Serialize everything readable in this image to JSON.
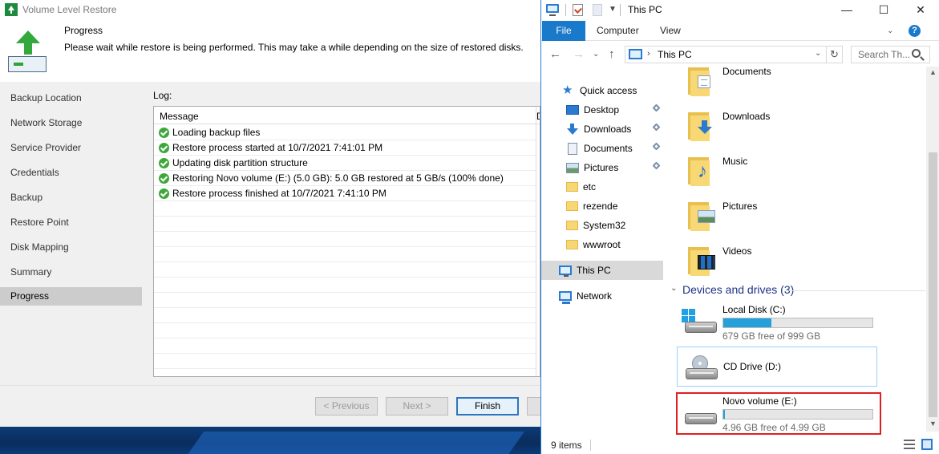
{
  "wizard": {
    "title": "Volume Level Restore",
    "header": {
      "title": "Progress",
      "description": "Please wait while restore is being performed. This may take a while depending on the size of restored disks."
    },
    "nav": [
      "Backup Location",
      "Network Storage",
      "Service Provider",
      "Credentials",
      "Backup",
      "Restore Point",
      "Disk Mapping",
      "Summary",
      "Progress"
    ],
    "active_step": "Progress",
    "log": {
      "label": "Log:",
      "column_message": "Message",
      "column_duration": "D",
      "entries": [
        {
          "status": "success",
          "message": "Loading backup files"
        },
        {
          "status": "success",
          "message": "Restore process started at 10/7/2021 7:41:01 PM"
        },
        {
          "status": "success",
          "message": "Updating disk partition structure"
        },
        {
          "status": "success",
          "message": "Restoring Novo volume (E:) (5.0 GB): 5.0 GB restored at 5 GB/s (100% done)"
        },
        {
          "status": "success",
          "message": "Restore process finished at 10/7/2021 7:41:10 PM"
        }
      ]
    },
    "buttons": {
      "previous": "< Previous",
      "next": "Next >",
      "finish": "Finish"
    }
  },
  "explorer": {
    "title": "This PC",
    "window_controls": {
      "minimize": "—",
      "maximize": "☐",
      "close": "✕"
    },
    "ribbon_tabs": {
      "file": "File",
      "computer": "Computer",
      "view": "View"
    },
    "address": {
      "path": "This PC"
    },
    "search": {
      "placeholder": "Search Th..."
    },
    "nav_pane": {
      "quick_access": "Quick access",
      "pinned": [
        "Desktop",
        "Downloads",
        "Documents",
        "Pictures"
      ],
      "folders": [
        "etc",
        "rezende",
        "System32",
        "wwwroot"
      ],
      "this_pc": "This PC",
      "network": "Network"
    },
    "folders": [
      "Documents",
      "Downloads",
      "Music",
      "Pictures",
      "Videos"
    ],
    "devices_group": "Devices and drives (3)",
    "drives": [
      {
        "name": "Local Disk (C:)",
        "free_text": "679 GB free of 999 GB",
        "used_fraction": 0.32
      },
      {
        "name": "CD Drive (D:)"
      },
      {
        "name": "Novo volume (E:)",
        "free_text": "4.96 GB free of 4.99 GB",
        "used_fraction": 0.01
      }
    ],
    "status": {
      "item_count": "9 items"
    },
    "colors": {
      "accent": "#1979ca",
      "drive_fill": "#26a0da",
      "highlight": "#e02020"
    }
  }
}
